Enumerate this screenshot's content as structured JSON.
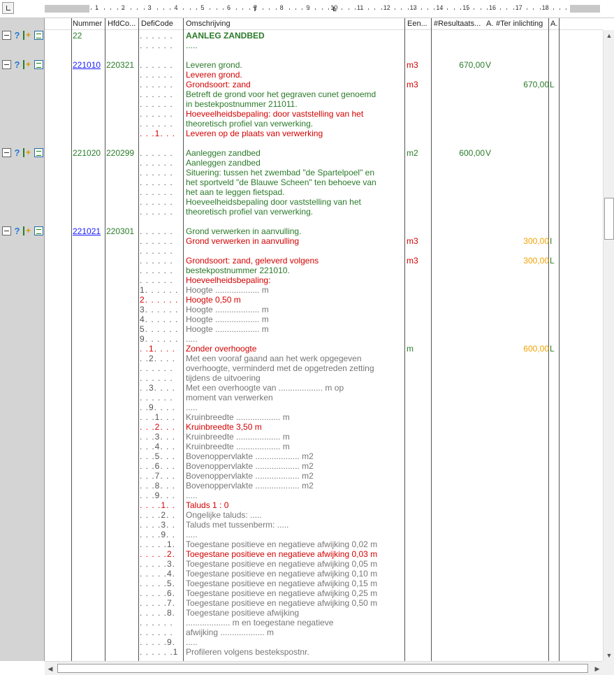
{
  "ruler": {
    "numbers": [
      "1",
      "2",
      "3",
      "4",
      "5",
      "6",
      "7",
      "8",
      "9",
      "10",
      "11",
      "12",
      "13",
      "14",
      "15",
      "16",
      "17",
      "18"
    ],
    "tab_marks": [
      "L",
      "T"
    ]
  },
  "columns": [
    "Nummer",
    "HfdCo...",
    "DefiCode",
    "Omschrijving",
    "Een...",
    "#Resultaats...",
    "A.",
    "#Ter inlichting",
    "A."
  ],
  "rows": [
    {
      "icons": "A",
      "num": "22",
      "numlink": false,
      "hfd": "",
      "defi": ". . . . . .",
      "text": "AANLEG ZANDBED",
      "tc": "g bold"
    },
    {
      "icons": "",
      "num": "",
      "hfd": "",
      "defi": ". . . . . .",
      "text": ".....",
      "tc": "g"
    },
    {
      "icons": "",
      "num": "",
      "hfd": "",
      "defi": "",
      "text": "",
      "tc": "g"
    },
    {
      "icons": "A",
      "num": "221010",
      "numlink": true,
      "hfd": "220321",
      "defi": ". . . . . .",
      "text": "Leveren grond.",
      "tc": "g",
      "unit": "m3",
      "uc": "r",
      "res": "670,00",
      "rc": "g",
      "a1": "V"
    },
    {
      "icons": "",
      "num": "",
      "hfd": "",
      "defi": ". . . . . .",
      "text": "Leveren grond.",
      "tc": "r"
    },
    {
      "icons": "",
      "num": "",
      "hfd": "",
      "defi": ". . . . . .",
      "text": "Grondsoort: zand",
      "tc": "r",
      "unit": "m3",
      "uc": "r",
      "ter": "670,00",
      "tc2": "g",
      "a2": "L"
    },
    {
      "icons": "",
      "num": "",
      "hfd": "",
      "defi": ". . . . . .",
      "text": "Betreft de grond voor het gegraven cunet genoemd",
      "tc": "g"
    },
    {
      "icons": "",
      "num": "",
      "hfd": "",
      "defi": ". . . . . .",
      "text": "in bestekpostnummer 211011.",
      "tc": "g"
    },
    {
      "icons": "",
      "num": "",
      "hfd": "",
      "defi": ". . . . . .",
      "text": "Hoeveelheidsbepaling: door vaststelling van het",
      "tc": "r"
    },
    {
      "icons": "",
      "num": "",
      "hfd": "",
      "defi": ". . . . . .",
      "text": "theoretisch profiel van verwerking.",
      "tc": "g"
    },
    {
      "icons": "",
      "num": "",
      "hfd": "",
      "defi": ". . .1. . .",
      "text": "Leveren op de plaats van verwerking",
      "tc": "r",
      "dc": "r"
    },
    {
      "icons": "",
      "num": "",
      "hfd": "",
      "defi": "",
      "text": "",
      "tc": "g"
    },
    {
      "icons": "A",
      "num": "221020",
      "numlink": false,
      "hfd": "220299",
      "defi": ". . . . . .",
      "text": "Aanleggen zandbed",
      "tc": "g",
      "unit": "m2",
      "uc": "g",
      "res": "600,00",
      "rc": "g",
      "a1": "V"
    },
    {
      "icons": "",
      "num": "",
      "hfd": "",
      "defi": ". . . . . .",
      "text": "Aanleggen zandbed",
      "tc": "g"
    },
    {
      "icons": "",
      "num": "",
      "hfd": "",
      "defi": ". . . . . .",
      "text": "Situering: tussen het zwembad \"de Spartelpoel\" en",
      "tc": "g"
    },
    {
      "icons": "",
      "num": "",
      "hfd": "",
      "defi": ". . . . . .",
      "text": "het sportveld \"de Blauwe Scheen\" ten behoeve van",
      "tc": "g"
    },
    {
      "icons": "",
      "num": "",
      "hfd": "",
      "defi": ". . . . . .",
      "text": "het aan te leggen fietspad.",
      "tc": "g"
    },
    {
      "icons": "",
      "num": "",
      "hfd": "",
      "defi": ". . . . . .",
      "text": "Hoeveelheidsbepaling door vaststelling van het",
      "tc": "g"
    },
    {
      "icons": "",
      "num": "",
      "hfd": "",
      "defi": ". . . . . .",
      "text": "theoretisch profiel van verwerking.",
      "tc": "g"
    },
    {
      "icons": "",
      "num": "",
      "hfd": "",
      "defi": "",
      "text": "",
      "tc": "g"
    },
    {
      "icons": "B",
      "num": "221021",
      "numlink": true,
      "hfd": "220301",
      "defi": ". . . . . .",
      "text": "Grond verwerken in aanvulling.",
      "tc": "g"
    },
    {
      "icons": "",
      "num": "",
      "hfd": "",
      "defi": ". . . . . .",
      "text": "Grond verwerken in aanvulling",
      "tc": "r",
      "unit": "m3",
      "uc": "r",
      "ter": "300,00",
      "tc2": "o",
      "a2": "I"
    },
    {
      "icons": "",
      "num": "",
      "hfd": "",
      "defi": ". . . . . .",
      "text": "",
      "tc": "g"
    },
    {
      "icons": "",
      "num": "",
      "hfd": "",
      "defi": ". . . . . .",
      "text": "Grondsoort: zand, geleverd volgens",
      "tc": "r",
      "unit": "m3",
      "uc": "r",
      "ter": "300,00",
      "tc2": "o",
      "a2": "L"
    },
    {
      "icons": "",
      "num": "",
      "hfd": "",
      "defi": ". . . . . .",
      "text": "bestekpostnummer 221010.",
      "tc": "g"
    },
    {
      "icons": "",
      "num": "",
      "hfd": "",
      "defi": ". . . . . .",
      "text": "Hoeveelheidsbepaling:",
      "tc": "r"
    },
    {
      "icons": "",
      "num": "",
      "hfd": "",
      "defi": "1. . . . . .",
      "text": "Hoogte ................... m",
      "tc": "gr"
    },
    {
      "icons": "",
      "num": "",
      "hfd": "",
      "defi": "2. . . . . .",
      "text": "Hoogte 0,50 m",
      "tc": "r",
      "dc": "r"
    },
    {
      "icons": "",
      "num": "",
      "hfd": "",
      "defi": "3. . . . . .",
      "text": "Hoogte ................... m",
      "tc": "gr"
    },
    {
      "icons": "",
      "num": "",
      "hfd": "",
      "defi": "4. . . . . .",
      "text": "Hoogte ................... m",
      "tc": "gr"
    },
    {
      "icons": "",
      "num": "",
      "hfd": "",
      "defi": "5. . . . . .",
      "text": "Hoogte ................... m",
      "tc": "gr"
    },
    {
      "icons": "",
      "num": "",
      "hfd": "",
      "defi": "9. . . . . .",
      "text": ".....",
      "tc": "gr"
    },
    {
      "icons": "",
      "num": "",
      "hfd": "",
      "defi": ". .1. . . .",
      "text": "Zonder overhoogte",
      "tc": "r",
      "dc": "r",
      "unit": "m",
      "uc": "g",
      "ter": "600,00",
      "tc2": "o",
      "a2": "L"
    },
    {
      "icons": "",
      "num": "",
      "hfd": "",
      "defi": ". .2. . . .",
      "text": "Met een vooraf gaand aan het werk opgegeven",
      "tc": "gr"
    },
    {
      "icons": "",
      "num": "",
      "hfd": "",
      "defi": ". . . . . .",
      "text": "overhoogte, verminderd met de opgetreden zetting",
      "tc": "gr"
    },
    {
      "icons": "",
      "num": "",
      "hfd": "",
      "defi": ". . . . . .",
      "text": "tijdens de uitvoering",
      "tc": "gr"
    },
    {
      "icons": "",
      "num": "",
      "hfd": "",
      "defi": ". .3. . . .",
      "text": "Met een overhoogte van ................... m op",
      "tc": "gr"
    },
    {
      "icons": "",
      "num": "",
      "hfd": "",
      "defi": ". . . . . .",
      "text": "moment van verwerken",
      "tc": "gr"
    },
    {
      "icons": "",
      "num": "",
      "hfd": "",
      "defi": ". .9. . . .",
      "text": ".....",
      "tc": "gr"
    },
    {
      "icons": "",
      "num": "",
      "hfd": "",
      "defi": ". . .1. . .",
      "text": "Kruinbreedte ................... m",
      "tc": "gr"
    },
    {
      "icons": "",
      "num": "",
      "hfd": "",
      "defi": ". . .2. . .",
      "text": "Kruinbreedte 3,50 m",
      "tc": "r",
      "dc": "r"
    },
    {
      "icons": "",
      "num": "",
      "hfd": "",
      "defi": ". . .3. . .",
      "text": "Kruinbreedte ................... m",
      "tc": "gr"
    },
    {
      "icons": "",
      "num": "",
      "hfd": "",
      "defi": ". . .4. . .",
      "text": "Kruinbreedte ................... m",
      "tc": "gr"
    },
    {
      "icons": "",
      "num": "",
      "hfd": "",
      "defi": ". . .5. . .",
      "text": "Bovenoppervlakte ................... m2",
      "tc": "gr"
    },
    {
      "icons": "",
      "num": "",
      "hfd": "",
      "defi": ". . .6. . .",
      "text": "Bovenoppervlakte ................... m2",
      "tc": "gr"
    },
    {
      "icons": "",
      "num": "",
      "hfd": "",
      "defi": ". . .7. . .",
      "text": "Bovenoppervlakte ................... m2",
      "tc": "gr"
    },
    {
      "icons": "",
      "num": "",
      "hfd": "",
      "defi": ". . .8. . .",
      "text": "Bovenoppervlakte ................... m2",
      "tc": "gr"
    },
    {
      "icons": "",
      "num": "",
      "hfd": "",
      "defi": ". . .9. . .",
      "text": ".....",
      "tc": "gr"
    },
    {
      "icons": "",
      "num": "",
      "hfd": "",
      "defi": ". . . .1. .",
      "text": "Taluds 1 : 0",
      "tc": "r",
      "dc": "r"
    },
    {
      "icons": "",
      "num": "",
      "hfd": "",
      "defi": ". . . .2. .",
      "text": "Ongelijke taluds: .....",
      "tc": "gr"
    },
    {
      "icons": "",
      "num": "",
      "hfd": "",
      "defi": ". . . .3. .",
      "text": "Taluds met tussenberm: .....",
      "tc": "gr"
    },
    {
      "icons": "",
      "num": "",
      "hfd": "",
      "defi": ". . . .9. .",
      "text": ".....",
      "tc": "gr"
    },
    {
      "icons": "",
      "num": "",
      "hfd": "",
      "defi": ". . . . .1.",
      "text": "Toegestane positieve en negatieve afwijking 0,02 m",
      "tc": "gr"
    },
    {
      "icons": "",
      "num": "",
      "hfd": "",
      "defi": ". . . . .2.",
      "text": "Toegestane positieve en negatieve afwijking 0,03 m",
      "tc": "r",
      "dc": "r"
    },
    {
      "icons": "",
      "num": "",
      "hfd": "",
      "defi": ". . . . .3.",
      "text": "Toegestane positieve en negatieve afwijking 0,05 m",
      "tc": "gr"
    },
    {
      "icons": "",
      "num": "",
      "hfd": "",
      "defi": ". . . . .4.",
      "text": "Toegestane positieve en negatieve afwijking 0,10 m",
      "tc": "gr"
    },
    {
      "icons": "",
      "num": "",
      "hfd": "",
      "defi": ". . . . .5.",
      "text": "Toegestane positieve en negatieve afwijking 0,15 m",
      "tc": "gr"
    },
    {
      "icons": "",
      "num": "",
      "hfd": "",
      "defi": ". . . . .6.",
      "text": "Toegestane positieve en negatieve afwijking 0,25 m",
      "tc": "gr"
    },
    {
      "icons": "",
      "num": "",
      "hfd": "",
      "defi": ". . . . .7.",
      "text": "Toegestane positieve en negatieve afwijking 0,50 m",
      "tc": "gr"
    },
    {
      "icons": "",
      "num": "",
      "hfd": "",
      "defi": ". . . . .8.",
      "text": "Toegestane positieve afwijking",
      "tc": "gr"
    },
    {
      "icons": "",
      "num": "",
      "hfd": "",
      "defi": ". . . . . .",
      "text": "................... m en toegestane negatieve",
      "tc": "gr"
    },
    {
      "icons": "",
      "num": "",
      "hfd": "",
      "defi": ". . . . . .",
      "text": "afwijking ................... m",
      "tc": "gr"
    },
    {
      "icons": "",
      "num": "",
      "hfd": "",
      "defi": ". . . . .9.",
      "text": ".....",
      "tc": "gr"
    },
    {
      "icons": "",
      "num": "",
      "hfd": "",
      "defi": ". . . . . .1",
      "text": "Profileren volgens bestekspostnr.",
      "tc": "gr"
    }
  ]
}
